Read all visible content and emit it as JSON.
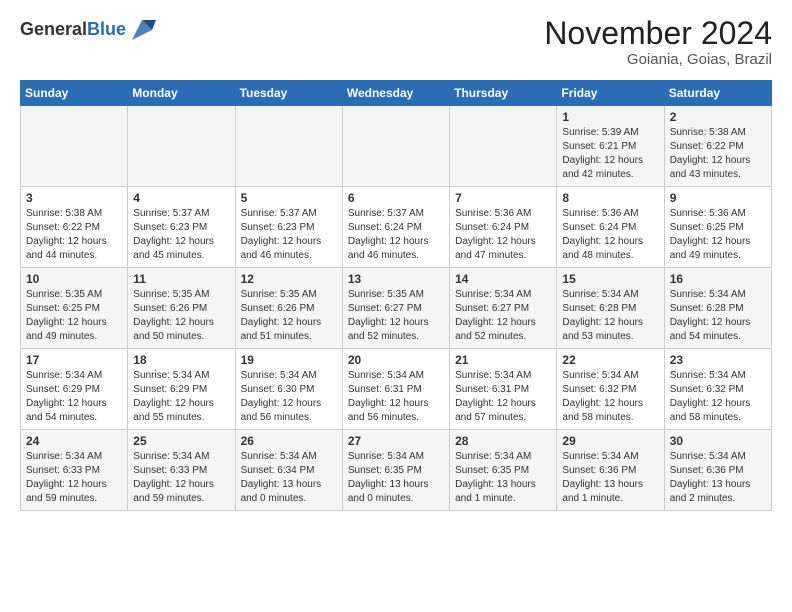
{
  "header": {
    "logo_general": "General",
    "logo_blue": "Blue",
    "month_title": "November 2024",
    "subtitle": "Goiania, Goias, Brazil"
  },
  "weekdays": [
    "Sunday",
    "Monday",
    "Tuesday",
    "Wednesday",
    "Thursday",
    "Friday",
    "Saturday"
  ],
  "weeks": [
    [
      {
        "day": "",
        "info": ""
      },
      {
        "day": "",
        "info": ""
      },
      {
        "day": "",
        "info": ""
      },
      {
        "day": "",
        "info": ""
      },
      {
        "day": "",
        "info": ""
      },
      {
        "day": "1",
        "info": "Sunrise: 5:39 AM\nSunset: 6:21 PM\nDaylight: 12 hours\nand 42 minutes."
      },
      {
        "day": "2",
        "info": "Sunrise: 5:38 AM\nSunset: 6:22 PM\nDaylight: 12 hours\nand 43 minutes."
      }
    ],
    [
      {
        "day": "3",
        "info": "Sunrise: 5:38 AM\nSunset: 6:22 PM\nDaylight: 12 hours\nand 44 minutes."
      },
      {
        "day": "4",
        "info": "Sunrise: 5:37 AM\nSunset: 6:23 PM\nDaylight: 12 hours\nand 45 minutes."
      },
      {
        "day": "5",
        "info": "Sunrise: 5:37 AM\nSunset: 6:23 PM\nDaylight: 12 hours\nand 46 minutes."
      },
      {
        "day": "6",
        "info": "Sunrise: 5:37 AM\nSunset: 6:24 PM\nDaylight: 12 hours\nand 46 minutes."
      },
      {
        "day": "7",
        "info": "Sunrise: 5:36 AM\nSunset: 6:24 PM\nDaylight: 12 hours\nand 47 minutes."
      },
      {
        "day": "8",
        "info": "Sunrise: 5:36 AM\nSunset: 6:24 PM\nDaylight: 12 hours\nand 48 minutes."
      },
      {
        "day": "9",
        "info": "Sunrise: 5:36 AM\nSunset: 6:25 PM\nDaylight: 12 hours\nand 49 minutes."
      }
    ],
    [
      {
        "day": "10",
        "info": "Sunrise: 5:35 AM\nSunset: 6:25 PM\nDaylight: 12 hours\nand 49 minutes."
      },
      {
        "day": "11",
        "info": "Sunrise: 5:35 AM\nSunset: 6:26 PM\nDaylight: 12 hours\nand 50 minutes."
      },
      {
        "day": "12",
        "info": "Sunrise: 5:35 AM\nSunset: 6:26 PM\nDaylight: 12 hours\nand 51 minutes."
      },
      {
        "day": "13",
        "info": "Sunrise: 5:35 AM\nSunset: 6:27 PM\nDaylight: 12 hours\nand 52 minutes."
      },
      {
        "day": "14",
        "info": "Sunrise: 5:34 AM\nSunset: 6:27 PM\nDaylight: 12 hours\nand 52 minutes."
      },
      {
        "day": "15",
        "info": "Sunrise: 5:34 AM\nSunset: 6:28 PM\nDaylight: 12 hours\nand 53 minutes."
      },
      {
        "day": "16",
        "info": "Sunrise: 5:34 AM\nSunset: 6:28 PM\nDaylight: 12 hours\nand 54 minutes."
      }
    ],
    [
      {
        "day": "17",
        "info": "Sunrise: 5:34 AM\nSunset: 6:29 PM\nDaylight: 12 hours\nand 54 minutes."
      },
      {
        "day": "18",
        "info": "Sunrise: 5:34 AM\nSunset: 6:29 PM\nDaylight: 12 hours\nand 55 minutes."
      },
      {
        "day": "19",
        "info": "Sunrise: 5:34 AM\nSunset: 6:30 PM\nDaylight: 12 hours\nand 56 minutes."
      },
      {
        "day": "20",
        "info": "Sunrise: 5:34 AM\nSunset: 6:31 PM\nDaylight: 12 hours\nand 56 minutes."
      },
      {
        "day": "21",
        "info": "Sunrise: 5:34 AM\nSunset: 6:31 PM\nDaylight: 12 hours\nand 57 minutes."
      },
      {
        "day": "22",
        "info": "Sunrise: 5:34 AM\nSunset: 6:32 PM\nDaylight: 12 hours\nand 58 minutes."
      },
      {
        "day": "23",
        "info": "Sunrise: 5:34 AM\nSunset: 6:32 PM\nDaylight: 12 hours\nand 58 minutes."
      }
    ],
    [
      {
        "day": "24",
        "info": "Sunrise: 5:34 AM\nSunset: 6:33 PM\nDaylight: 12 hours\nand 59 minutes."
      },
      {
        "day": "25",
        "info": "Sunrise: 5:34 AM\nSunset: 6:33 PM\nDaylight: 12 hours\nand 59 minutes."
      },
      {
        "day": "26",
        "info": "Sunrise: 5:34 AM\nSunset: 6:34 PM\nDaylight: 13 hours\nand 0 minutes."
      },
      {
        "day": "27",
        "info": "Sunrise: 5:34 AM\nSunset: 6:35 PM\nDaylight: 13 hours\nand 0 minutes."
      },
      {
        "day": "28",
        "info": "Sunrise: 5:34 AM\nSunset: 6:35 PM\nDaylight: 13 hours\nand 1 minute."
      },
      {
        "day": "29",
        "info": "Sunrise: 5:34 AM\nSunset: 6:36 PM\nDaylight: 13 hours\nand 1 minute."
      },
      {
        "day": "30",
        "info": "Sunrise: 5:34 AM\nSunset: 6:36 PM\nDaylight: 13 hours\nand 2 minutes."
      }
    ]
  ]
}
